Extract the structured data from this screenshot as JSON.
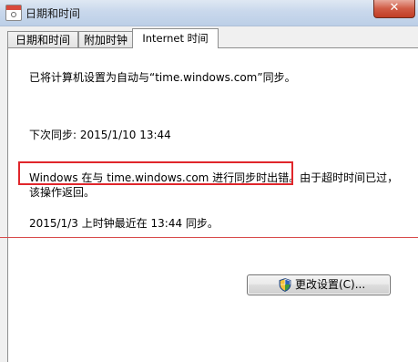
{
  "window": {
    "title": "日期和时间",
    "close_label": "✕",
    "close_icon": "close-icon",
    "app_icon": "calendar-clock-icon"
  },
  "tabs": [
    {
      "label": "日期和时间",
      "selected": false
    },
    {
      "label": "附加时钟",
      "selected": false
    },
    {
      "label": "Internet 时间",
      "selected": true
    }
  ],
  "internet_time": {
    "status_line": "已将计算机设置为自动与“time.windows.com”同步。",
    "next_sync": "下次同步: 2015/1/10 13:44",
    "error_highlight": "Windows 在与 time.windows.com 进行同步时出错。",
    "error_rest_1": "由于超时时间已过，",
    "error_rest_2": "该操作返回。",
    "last_sync": "2015/1/3 上时钟最近在 13:44 同步。",
    "change_settings_label": "更改设置(C)...",
    "shield_icon": "uac-shield-icon"
  },
  "colors": {
    "highlight_border": "#e0262b",
    "annotation_line": "#d84a4a",
    "close_button": "#c13d24"
  }
}
